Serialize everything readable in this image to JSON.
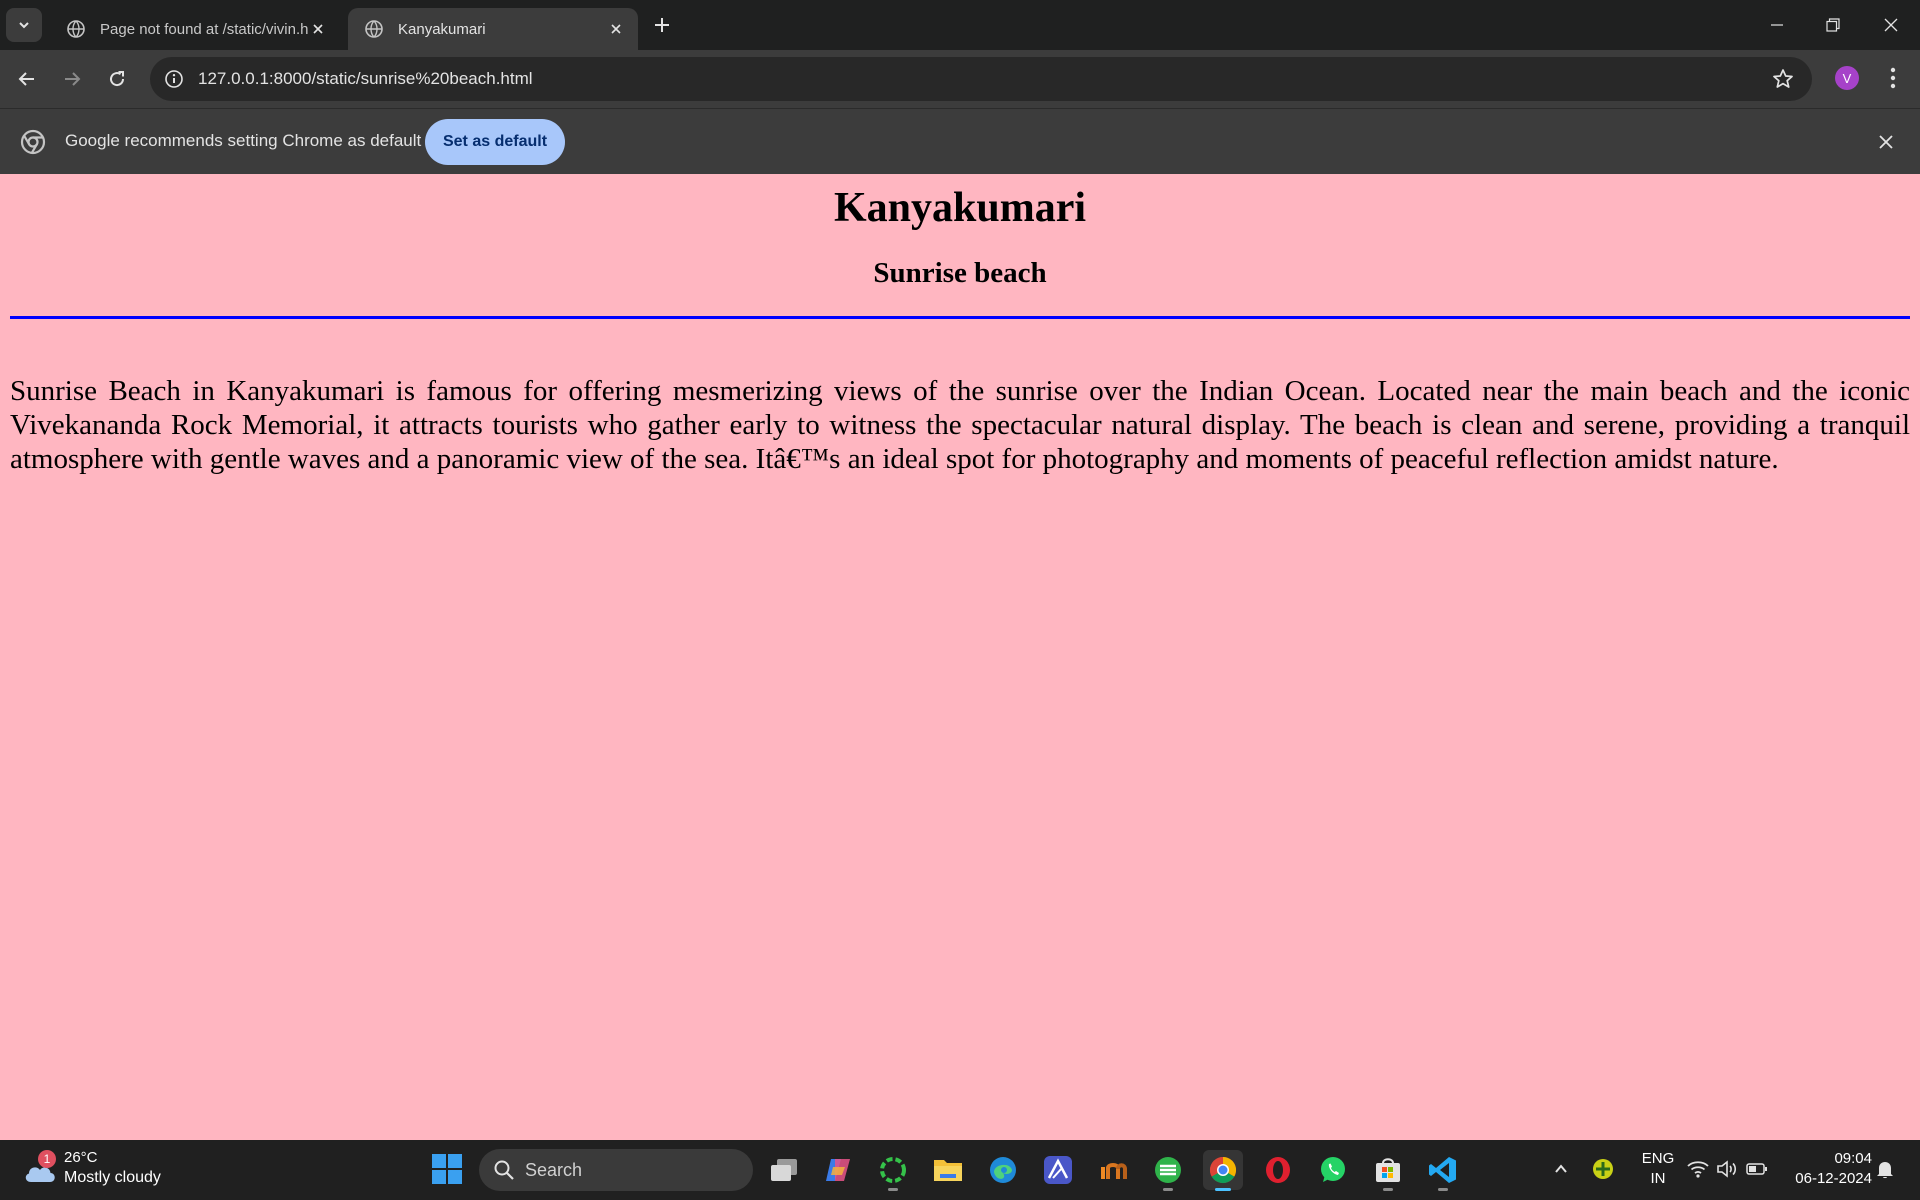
{
  "browser": {
    "tabs": [
      {
        "title": "Page not found at /static/vivin.h",
        "active": false
      },
      {
        "title": "Kanyakumari",
        "active": true
      }
    ],
    "url": "127.0.0.1:8000/static/sunrise%20beach.html",
    "profile_initial": "V",
    "infobar": {
      "message": "Google recommends setting Chrome as default",
      "button_label": "Set as default"
    }
  },
  "page": {
    "background": "#ffb6c1",
    "rule_color": "#0000ff",
    "title": "Kanyakumari",
    "subtitle": "Sunrise beach",
    "paragraph": "Sunrise Beach in Kanyakumari is famous for offering mesmerizing views of the sunrise over the Indian Ocean. Located near the main beach and the iconic Vivekananda Rock Memorial, it attracts tourists who gather early to witness the spectacular natural display. The beach is clean and serene, providing a tranquil atmosphere with gentle waves and a panoramic view of the sea. Itâ€™s an ideal spot for photography and moments of peaceful reflection amidst nature."
  },
  "taskbar": {
    "weather": {
      "temp": "26°C",
      "condition": "Mostly cloudy",
      "badge": "1"
    },
    "search_placeholder": "Search",
    "apps": [
      "task-view",
      "copilot",
      "green-ring-app",
      "file-explorer",
      "edge",
      "affinity",
      "inkscape-like",
      "green-browser",
      "chrome",
      "opera",
      "whatsapp",
      "microsoft-store",
      "vscode"
    ],
    "language": {
      "line1": "ENG",
      "line2": "IN"
    },
    "time": "09:04",
    "date": "06-12-2024"
  }
}
